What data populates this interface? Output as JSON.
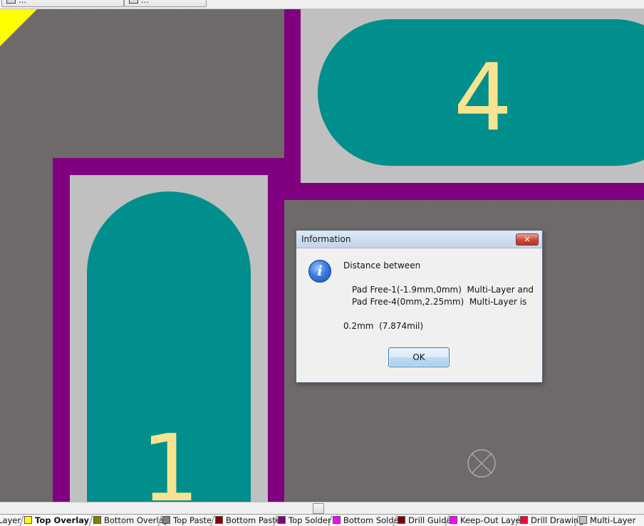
{
  "toolbar": {
    "btn1_label": "…",
    "btn2_label": "…"
  },
  "pcb": {
    "pad_1_label": "1",
    "pad_4_label": "4",
    "colors": {
      "board": "#6e6a6a",
      "solder_mask": "#800080",
      "paste": "#c0c0c0",
      "pad": "#008f8c",
      "overlay": "#ffff00",
      "label": "#f8e390"
    }
  },
  "dialog": {
    "title": "Information",
    "close_label": "✕",
    "line1": "Distance between",
    "line2": "Pad Free-1(-1.9mm,0mm)  Multi-Layer and",
    "line3": "Pad Free-4(0mm,2.25mm)  Multi-Layer is",
    "line4": "0.2mm  (7.874mil)",
    "ok_label": "OK",
    "icon": "information-icon"
  },
  "layer_tabs": [
    {
      "label": "Layer",
      "color": "#808080"
    },
    {
      "label": "Top Overlay",
      "color": "#ffff00",
      "active": true
    },
    {
      "label": "Bottom Overlay",
      "color": "#808000"
    },
    {
      "label": "Top Paste",
      "color": "#808080"
    },
    {
      "label": "Bottom Paste",
      "color": "#800000"
    },
    {
      "label": "Top Solder",
      "color": "#800080"
    },
    {
      "label": "Bottom Solder",
      "color": "#ff00ff"
    },
    {
      "label": "Drill Guide",
      "color": "#800000"
    },
    {
      "label": "Keep-Out Layer",
      "color": "#ff00ff"
    },
    {
      "label": "Drill Drawing",
      "color": "#ff0033"
    },
    {
      "label": "Multi-Layer",
      "color": "#c0c0c0"
    }
  ]
}
